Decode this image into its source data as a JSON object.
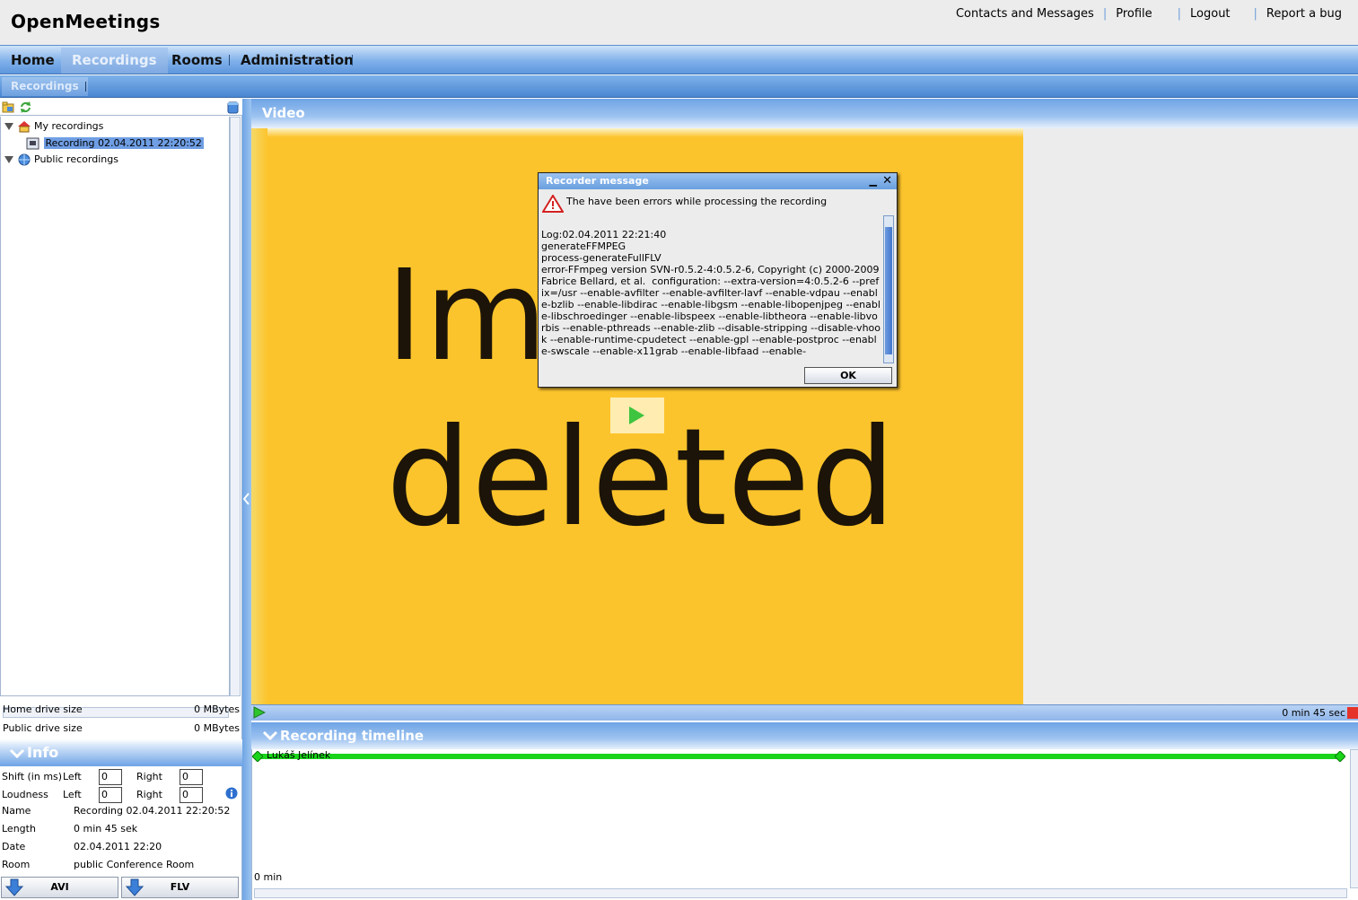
{
  "app": {
    "title": "OpenMeetings"
  },
  "toplinks": [
    "Contacts and Messages",
    "Profile",
    "Logout",
    "Report a bug"
  ],
  "nav": {
    "items": [
      {
        "label": "Home",
        "active": false
      },
      {
        "label": "Recordings",
        "active": true
      },
      {
        "label": "Rooms",
        "active": false
      },
      {
        "label": "Administration",
        "active": false
      }
    ]
  },
  "subnav": {
    "item": "Recordings"
  },
  "tree": {
    "my_recordings": "My recordings",
    "recording_item": "Recording 02.04.2011 22:20:52",
    "public_recordings": "Public recordings"
  },
  "drive": {
    "home_label": "Home drive size",
    "home_value": "0 MBytes",
    "public_label": "Public drive size",
    "public_value": "0 MBytes"
  },
  "info": {
    "header": "Info",
    "shift_label": "Shift (in ms)",
    "loudness_label": "Loudness",
    "left_label": "Left",
    "right_label": "Right",
    "shift_left": "0",
    "shift_right": "0",
    "loud_left": "0",
    "loud_right": "0",
    "name_label": "Name",
    "name_value": "Recording 02.04.2011 22:20:52",
    "length_label": "Length",
    "length_value": "0 min 45 sek",
    "date_label": "Date",
    "date_value": "02.04.2011 22:20",
    "room_label": "Room",
    "room_value": "public Conference Room",
    "avi_button": "AVI",
    "flv_button": "FLV"
  },
  "video": {
    "header": "Video",
    "image_text_line1": "Im",
    "image_text_line2": "deleted",
    "time": "0 min 45 sec"
  },
  "timeline": {
    "header": "Recording timeline",
    "user": "Lukáš Jelínek",
    "zero": "0 min"
  },
  "dialog": {
    "title": "Recorder message",
    "message": "The have been errors while processing the recording",
    "log": "Log:02.04.2011 22:21:40\ngenerateFFMPEG\nprocess-generateFullFLV\nerror-FFmpeg version SVN-r0.5.2-4:0.5.2-6, Copyright (c) 2000-2009 Fabrice Bellard, et al.  configuration: --extra-version=4:0.5.2-6 --prefix=/usr --enable-avfilter --enable-avfilter-lavf --enable-vdpau --enable-bzlib --enable-libdirac --enable-libgsm --enable-libopenjpeg --enable-libschroedinger --enable-libspeex --enable-libtheora --enable-libvorbis --enable-pthreads --enable-zlib --disable-stripping --disable-vhook --enable-runtime-cpudetect --enable-gpl --enable-postproc --enable-swscale --enable-x11grab --enable-libfaad --enable-",
    "ok": "OK"
  },
  "colors": {
    "accent_blue": "#6fa4e6",
    "video_bg": "#fcc42c",
    "timeline_track": "#19d419"
  }
}
